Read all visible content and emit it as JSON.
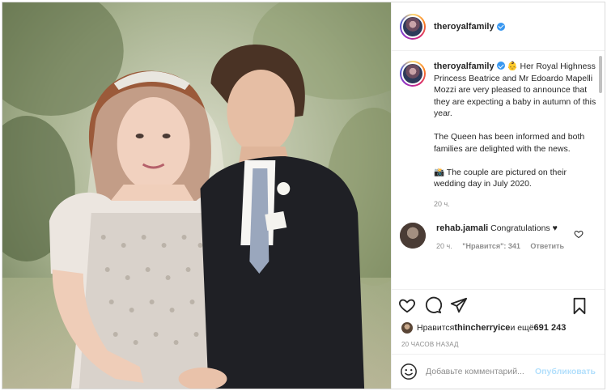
{
  "post": {
    "author": "theroyalfamily",
    "verified": true,
    "photo_alt": "wedding photo"
  },
  "caption": {
    "author": "theroyalfamily",
    "intro": " 👶 Her Royal Highness Princess Beatrice and Mr Edoardo Mapelli Mozzi are very pleased to announce that they are expecting a baby in autumn of this year.",
    "para2": "The Queen has been informed and both families are delighted with the news.",
    "para3": "📸 The couple are pictured on their wedding day in July 2020.",
    "time": "20 ч."
  },
  "comment": {
    "author": "rehab.jamali",
    "text": "Congratulations ♥",
    "time": "20 ч.",
    "likes": "\"Нравится\": 341",
    "reply": "Ответить"
  },
  "actions": {
    "like_icon": "heart-icon",
    "comment_icon": "comment-icon",
    "share_icon": "share-icon",
    "save_icon": "bookmark-icon"
  },
  "likes": {
    "prefix": "Нравится ",
    "user": "thincherryice",
    "middle": " и ещё ",
    "count": "691 243"
  },
  "date": "20 ЧАСОВ НАЗАД",
  "add_comment": {
    "placeholder": "Добавьте комментарий...",
    "publish": "Опубликовать"
  },
  "colors": {
    "verified": "#3897f0",
    "publish_disabled": "#b2dffc",
    "muted": "#8e8e8e",
    "border": "#dbdbdb"
  }
}
